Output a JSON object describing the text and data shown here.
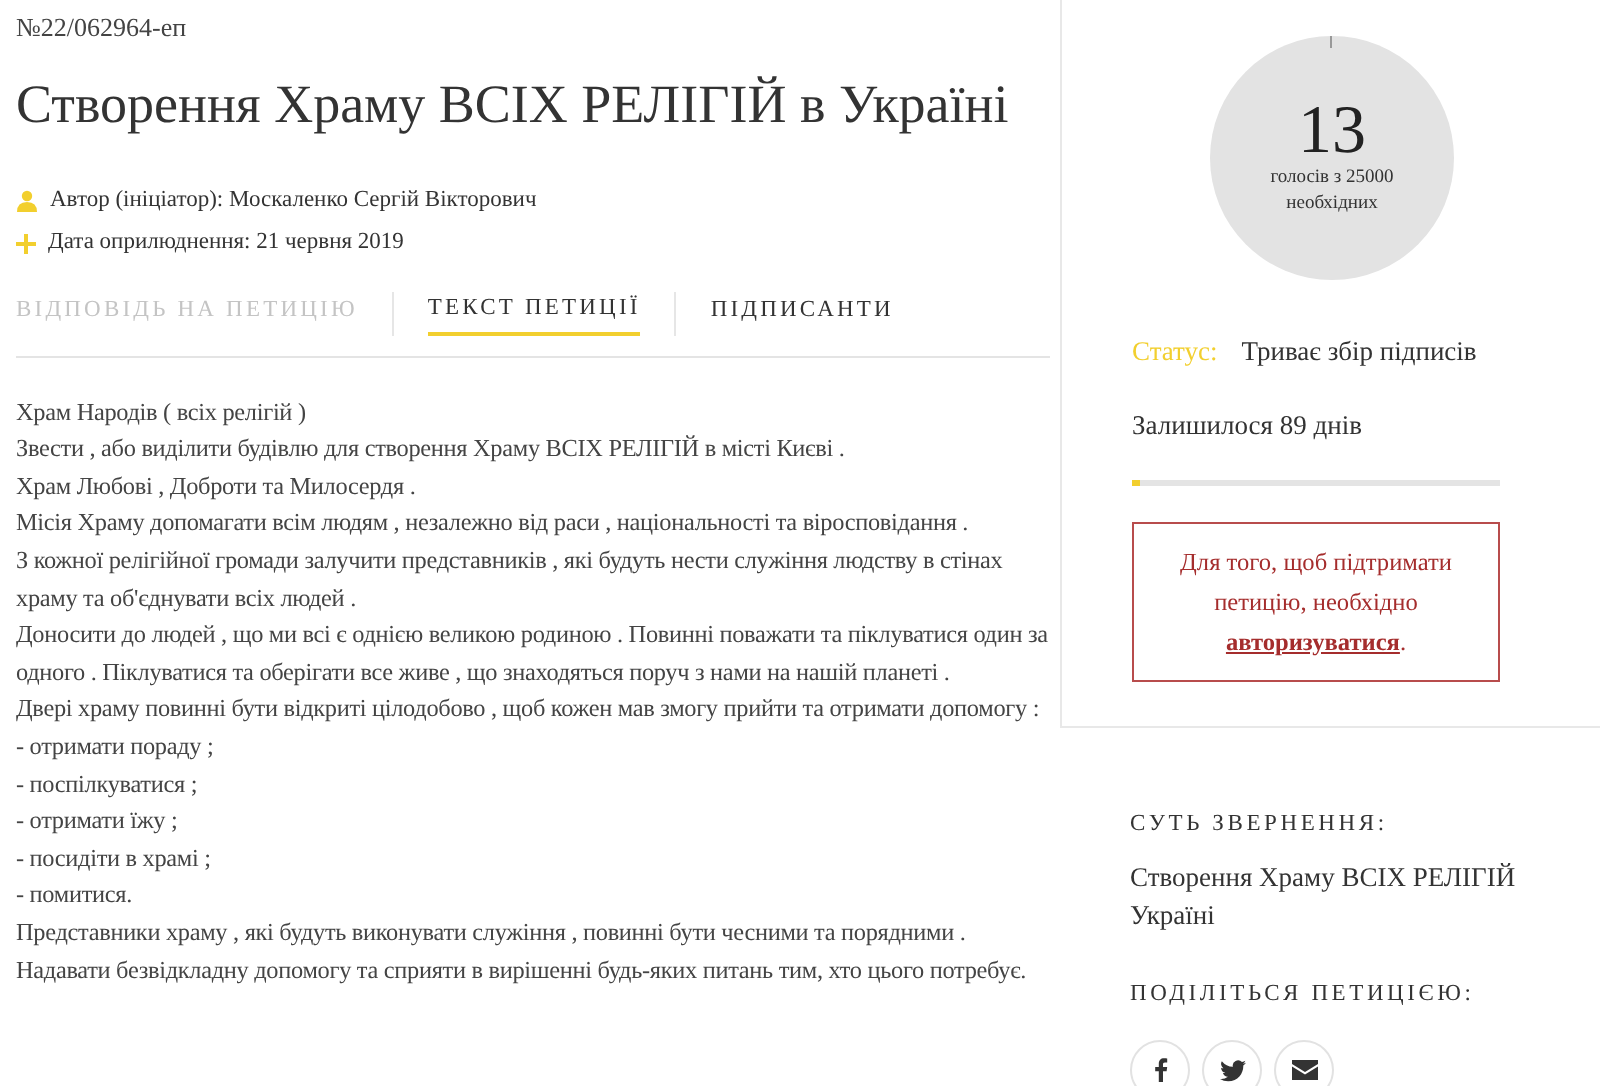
{
  "petition_number": "№22/062964-еп",
  "title": "Створення Храму ВСІХ РЕЛІГІЙ в Україні",
  "meta": [
    {
      "kind": "author",
      "text": "Автор (ініціатор): Москаленко Сергій Вікторович"
    },
    {
      "kind": "date",
      "text": "Дата оприлюднення: 21 червня 2019"
    }
  ],
  "tabs": [
    {
      "label": "ВІДПОВІДЬ НА ПЕТИЦІЮ",
      "selected": false,
      "disabled": true
    },
    {
      "label": "ТЕКСТ ПЕТИЦІЇ",
      "selected": true,
      "disabled": false
    },
    {
      "label": "ПІДПИСАНТИ",
      "selected": false,
      "disabled": false
    }
  ],
  "petition_text": [
    "Храм Народів ( всіх релігій )",
    "Звести , або виділити будівлю для створення Храму ВСІХ РЕЛІГІЙ в місті Києві .",
    "Храм Любові , Доброти та Милосердя .",
    "Місія Храму допомагати всім людям , незалежно від раси , національності та віросповідання .",
    "З кожної релігійної громади залучити представників , які будуть нести служіння людству в стінах храму та об'єднувати всіх людей .",
    "Доносити до людей , що ми всі є однією великою родиною . Повинні поважати та піклуватися один за одного . Піклуватися та оберігати все живе , що знаходяться поруч з нами на нашій планеті .",
    "Двері храму повинні бути відкриті цілодобово , щоб кожен мав змогу прийти та отримати допомогу :",
    "- отримати пораду ;",
    "- поспілкуватися ;",
    "- отримати їжу ;",
    "- посидіти в храмі ;",
    "- помитися.",
    "Представники храму , які будуть виконувати служіння , повинні бути чесними та порядними .",
    "Надавати безвідкладну допомогу та сприяти в вирішенні будь-яких питань тим, хто цього потребує."
  ],
  "votes": {
    "count": "13",
    "caption": "голосів з 25000 необхідних"
  },
  "status": {
    "label": "Статус:",
    "value": "Триває збір підписів"
  },
  "days_left": "Залишилося 89 днів",
  "progress": {
    "level": 0.02
  },
  "login_notice": {
    "text": "Для того, щоб підтримати петицію, необхідно",
    "link": "авторизуватися",
    "tail": "."
  },
  "essence": {
    "heading": "СУТЬ ЗВЕРНЕННЯ:",
    "lines": [
      "Створення Храму ВСІХ РЕЛІГІЙ",
      "Україні"
    ]
  },
  "share": {
    "heading": "ПОДІЛІТЬСЯ ПЕТИЦІЄЮ:",
    "buttons": [
      {
        "kind": "facebook"
      },
      {
        "kind": "twitter"
      },
      {
        "kind": "email"
      }
    ]
  }
}
